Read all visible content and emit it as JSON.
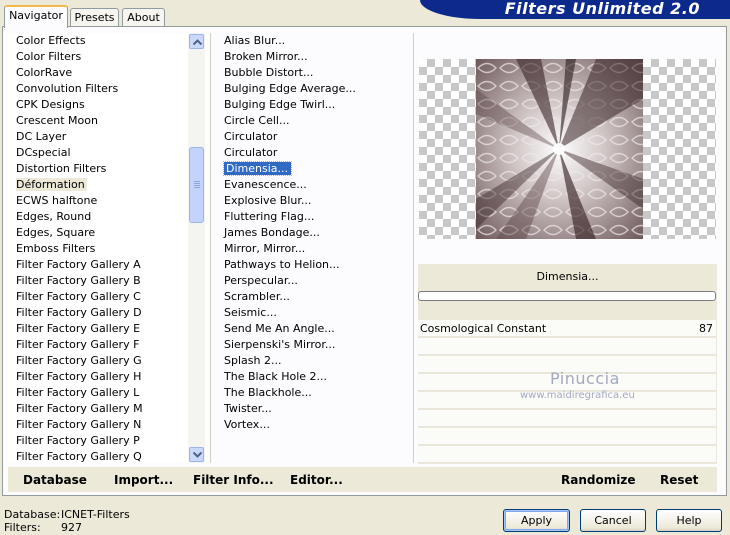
{
  "banner": {
    "title": "Filters Unlimited 2.0"
  },
  "tabs": [
    {
      "label": "Navigator",
      "active": true
    },
    {
      "label": "Presets",
      "active": false
    },
    {
      "label": "About",
      "active": false
    }
  ],
  "categories": [
    "Color Effects",
    "Color Filters",
    "ColorRave",
    "Convolution Filters",
    "CPK Designs",
    "Crescent Moon",
    "DC Layer",
    "DCspecial",
    "Distortion Filters",
    "Déformation",
    "ECWS halftone",
    "Edges, Round",
    "Edges, Square",
    "Emboss Filters",
    "Filter Factory Gallery A",
    "Filter Factory Gallery B",
    "Filter Factory Gallery C",
    "Filter Factory Gallery D",
    "Filter Factory Gallery E",
    "Filter Factory Gallery F",
    "Filter Factory Gallery G",
    "Filter Factory Gallery H",
    "Filter Factory Gallery L",
    "Filter Factory Gallery M",
    "Filter Factory Gallery N",
    "Filter Factory Gallery P",
    "Filter Factory Gallery Q"
  ],
  "selected_category": "Déformation",
  "filters": [
    "Alias Blur...",
    "Broken Mirror...",
    "Bubble Distort...",
    "Bulging Edge Average...",
    "Bulging Edge Twirl...",
    "Circle Cell...",
    "Circulator",
    "Circulator",
    "Dimensia...",
    "Evanescence...",
    "Explosive Blur...",
    "Fluttering Flag...",
    "James Bondage...",
    "Mirror, Mirror...",
    "Pathways to Helion...",
    "Perspecular...",
    "Scrambler...",
    "Seismic...",
    "Send Me An Angle...",
    "Sierpenski's Mirror...",
    "Splash 2...",
    "The Black Hole 2...",
    "The Blackhole...",
    "Twister...",
    "Vortex..."
  ],
  "selected_filter": "Dimensia...",
  "preview": {
    "filter_title": "Dimensia..."
  },
  "params": [
    {
      "label": "Cosmological Constant",
      "value": "87"
    }
  ],
  "watermark": {
    "line1": "Pinuccia",
    "line2": "www.maidiregrafica.eu"
  },
  "actions": {
    "database": "Database",
    "import": "Import...",
    "filter_info": "Filter Info...",
    "editor": "Editor...",
    "randomize": "Randomize",
    "reset": "Reset"
  },
  "status": {
    "database_label": "Database:",
    "database_value": "ICNET-Filters",
    "filters_label": "Filters:",
    "filters_value": "927"
  },
  "buttons": {
    "apply": "Apply",
    "cancel": "Cancel",
    "help": "Help"
  }
}
